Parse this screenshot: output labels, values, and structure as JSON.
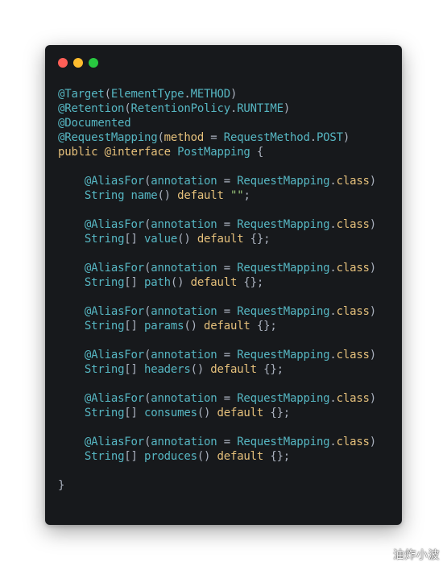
{
  "colors": {
    "window_bg": "#17191c",
    "dot_close": "#ff5f57",
    "dot_minimize": "#febc2e",
    "dot_maximize": "#28c840",
    "annotation": "#56b6c2",
    "keyword": "#e5c07b",
    "type": "#56b6c2",
    "punct": "#abb2bf",
    "string": "#98c379"
  },
  "window": {
    "controls": [
      "close",
      "minimize",
      "maximize"
    ]
  },
  "code": {
    "lines": [
      [
        {
          "t": "@Target",
          "c": "annotation"
        },
        {
          "t": "(",
          "c": "punct"
        },
        {
          "t": "ElementType",
          "c": "type"
        },
        {
          "t": ".",
          "c": "punct"
        },
        {
          "t": "METHOD",
          "c": "type"
        },
        {
          "t": ")",
          "c": "punct"
        }
      ],
      [
        {
          "t": "@Retention",
          "c": "annotation"
        },
        {
          "t": "(",
          "c": "punct"
        },
        {
          "t": "RetentionPolicy",
          "c": "type"
        },
        {
          "t": ".",
          "c": "punct"
        },
        {
          "t": "RUNTIME",
          "c": "type"
        },
        {
          "t": ")",
          "c": "punct"
        }
      ],
      [
        {
          "t": "@Documented",
          "c": "annotation"
        }
      ],
      [
        {
          "t": "@RequestMapping",
          "c": "annotation"
        },
        {
          "t": "(",
          "c": "punct"
        },
        {
          "t": "method",
          "c": "keyword"
        },
        {
          "t": " = ",
          "c": "punct"
        },
        {
          "t": "RequestMethod",
          "c": "type"
        },
        {
          "t": ".",
          "c": "punct"
        },
        {
          "t": "POST",
          "c": "type"
        },
        {
          "t": ")",
          "c": "punct"
        }
      ],
      [
        {
          "t": "public",
          "c": "keyword"
        },
        {
          "t": " ",
          "c": "punct"
        },
        {
          "t": "@interface",
          "c": "keyword"
        },
        {
          "t": " ",
          "c": "punct"
        },
        {
          "t": "PostMapping",
          "c": "type"
        },
        {
          "t": " {",
          "c": "punct"
        }
      ],
      [],
      [
        {
          "t": "    ",
          "c": "punct"
        },
        {
          "t": "@AliasFor",
          "c": "annotation"
        },
        {
          "t": "(",
          "c": "punct"
        },
        {
          "t": "annotation",
          "c": "type"
        },
        {
          "t": " = ",
          "c": "punct"
        },
        {
          "t": "RequestMapping",
          "c": "type"
        },
        {
          "t": ".",
          "c": "punct"
        },
        {
          "t": "class",
          "c": "keyword"
        },
        {
          "t": ")",
          "c": "punct"
        }
      ],
      [
        {
          "t": "    ",
          "c": "punct"
        },
        {
          "t": "String",
          "c": "type"
        },
        {
          "t": " ",
          "c": "punct"
        },
        {
          "t": "name",
          "c": "type"
        },
        {
          "t": "() ",
          "c": "punct"
        },
        {
          "t": "default",
          "c": "keyword"
        },
        {
          "t": " ",
          "c": "punct"
        },
        {
          "t": "\"\"",
          "c": "string"
        },
        {
          "t": ";",
          "c": "punct"
        }
      ],
      [],
      [
        {
          "t": "    ",
          "c": "punct"
        },
        {
          "t": "@AliasFor",
          "c": "annotation"
        },
        {
          "t": "(",
          "c": "punct"
        },
        {
          "t": "annotation",
          "c": "type"
        },
        {
          "t": " = ",
          "c": "punct"
        },
        {
          "t": "RequestMapping",
          "c": "type"
        },
        {
          "t": ".",
          "c": "punct"
        },
        {
          "t": "class",
          "c": "keyword"
        },
        {
          "t": ")",
          "c": "punct"
        }
      ],
      [
        {
          "t": "    ",
          "c": "punct"
        },
        {
          "t": "String",
          "c": "type"
        },
        {
          "t": "[] ",
          "c": "punct"
        },
        {
          "t": "value",
          "c": "type"
        },
        {
          "t": "() ",
          "c": "punct"
        },
        {
          "t": "default",
          "c": "keyword"
        },
        {
          "t": " {};",
          "c": "punct"
        }
      ],
      [],
      [
        {
          "t": "    ",
          "c": "punct"
        },
        {
          "t": "@AliasFor",
          "c": "annotation"
        },
        {
          "t": "(",
          "c": "punct"
        },
        {
          "t": "annotation",
          "c": "type"
        },
        {
          "t": " = ",
          "c": "punct"
        },
        {
          "t": "RequestMapping",
          "c": "type"
        },
        {
          "t": ".",
          "c": "punct"
        },
        {
          "t": "class",
          "c": "keyword"
        },
        {
          "t": ")",
          "c": "punct"
        }
      ],
      [
        {
          "t": "    ",
          "c": "punct"
        },
        {
          "t": "String",
          "c": "type"
        },
        {
          "t": "[] ",
          "c": "punct"
        },
        {
          "t": "path",
          "c": "type"
        },
        {
          "t": "() ",
          "c": "punct"
        },
        {
          "t": "default",
          "c": "keyword"
        },
        {
          "t": " {};",
          "c": "punct"
        }
      ],
      [],
      [
        {
          "t": "    ",
          "c": "punct"
        },
        {
          "t": "@AliasFor",
          "c": "annotation"
        },
        {
          "t": "(",
          "c": "punct"
        },
        {
          "t": "annotation",
          "c": "type"
        },
        {
          "t": " = ",
          "c": "punct"
        },
        {
          "t": "RequestMapping",
          "c": "type"
        },
        {
          "t": ".",
          "c": "punct"
        },
        {
          "t": "class",
          "c": "keyword"
        },
        {
          "t": ")",
          "c": "punct"
        }
      ],
      [
        {
          "t": "    ",
          "c": "punct"
        },
        {
          "t": "String",
          "c": "type"
        },
        {
          "t": "[] ",
          "c": "punct"
        },
        {
          "t": "params",
          "c": "type"
        },
        {
          "t": "() ",
          "c": "punct"
        },
        {
          "t": "default",
          "c": "keyword"
        },
        {
          "t": " {};",
          "c": "punct"
        }
      ],
      [],
      [
        {
          "t": "    ",
          "c": "punct"
        },
        {
          "t": "@AliasFor",
          "c": "annotation"
        },
        {
          "t": "(",
          "c": "punct"
        },
        {
          "t": "annotation",
          "c": "type"
        },
        {
          "t": " = ",
          "c": "punct"
        },
        {
          "t": "RequestMapping",
          "c": "type"
        },
        {
          "t": ".",
          "c": "punct"
        },
        {
          "t": "class",
          "c": "keyword"
        },
        {
          "t": ")",
          "c": "punct"
        }
      ],
      [
        {
          "t": "    ",
          "c": "punct"
        },
        {
          "t": "String",
          "c": "type"
        },
        {
          "t": "[] ",
          "c": "punct"
        },
        {
          "t": "headers",
          "c": "type"
        },
        {
          "t": "() ",
          "c": "punct"
        },
        {
          "t": "default",
          "c": "keyword"
        },
        {
          "t": " {};",
          "c": "punct"
        }
      ],
      [],
      [
        {
          "t": "    ",
          "c": "punct"
        },
        {
          "t": "@AliasFor",
          "c": "annotation"
        },
        {
          "t": "(",
          "c": "punct"
        },
        {
          "t": "annotation",
          "c": "type"
        },
        {
          "t": " = ",
          "c": "punct"
        },
        {
          "t": "RequestMapping",
          "c": "type"
        },
        {
          "t": ".",
          "c": "punct"
        },
        {
          "t": "class",
          "c": "keyword"
        },
        {
          "t": ")",
          "c": "punct"
        }
      ],
      [
        {
          "t": "    ",
          "c": "punct"
        },
        {
          "t": "String",
          "c": "type"
        },
        {
          "t": "[] ",
          "c": "punct"
        },
        {
          "t": "consumes",
          "c": "type"
        },
        {
          "t": "() ",
          "c": "punct"
        },
        {
          "t": "default",
          "c": "keyword"
        },
        {
          "t": " {};",
          "c": "punct"
        }
      ],
      [],
      [
        {
          "t": "    ",
          "c": "punct"
        },
        {
          "t": "@AliasFor",
          "c": "annotation"
        },
        {
          "t": "(",
          "c": "punct"
        },
        {
          "t": "annotation",
          "c": "type"
        },
        {
          "t": " = ",
          "c": "punct"
        },
        {
          "t": "RequestMapping",
          "c": "type"
        },
        {
          "t": ".",
          "c": "punct"
        },
        {
          "t": "class",
          "c": "keyword"
        },
        {
          "t": ")",
          "c": "punct"
        }
      ],
      [
        {
          "t": "    ",
          "c": "punct"
        },
        {
          "t": "String",
          "c": "type"
        },
        {
          "t": "[] ",
          "c": "punct"
        },
        {
          "t": "produces",
          "c": "type"
        },
        {
          "t": "() ",
          "c": "punct"
        },
        {
          "t": "default",
          "c": "keyword"
        },
        {
          "t": " {};",
          "c": "punct"
        }
      ],
      [],
      [
        {
          "t": "}",
          "c": "punct"
        }
      ]
    ]
  },
  "watermark": {
    "text": "油炸小波"
  }
}
